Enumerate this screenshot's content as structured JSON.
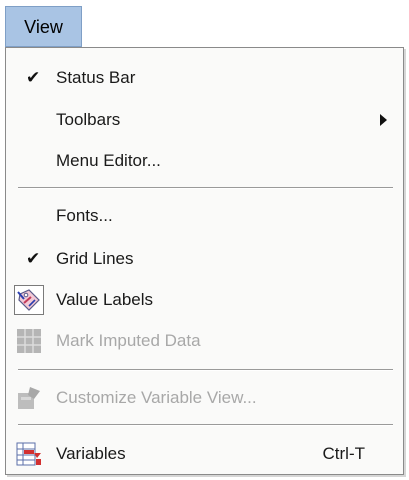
{
  "menu": {
    "title": "View",
    "items": [
      {
        "label": "Status Bar",
        "checked": true
      },
      {
        "label": "Toolbars",
        "submenu": true
      },
      {
        "label": "Menu Editor..."
      },
      {
        "label": "Fonts..."
      },
      {
        "label": "Grid Lines",
        "checked": true
      },
      {
        "label": "Value Labels",
        "icon": "value-labels-tag-icon"
      },
      {
        "label": "Mark Imputed Data",
        "icon": "grid-icon",
        "disabled": true
      },
      {
        "label": "Customize Variable View...",
        "icon": "customize-variable-icon",
        "disabled": true
      },
      {
        "label": "Variables",
        "icon": "variables-icon",
        "shortcut": "Ctrl-T"
      }
    ]
  },
  "colors": {
    "title_highlight": "#a9c4e4",
    "menu_background": "#fafaf9",
    "disabled_text": "#a8a8a8"
  }
}
